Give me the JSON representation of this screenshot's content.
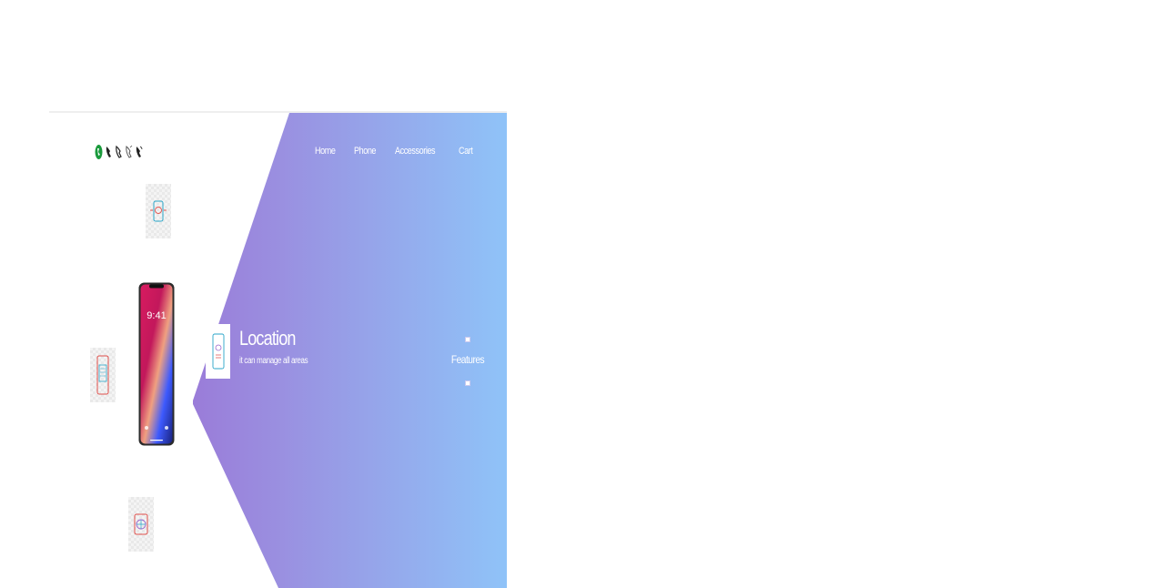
{
  "nav": {
    "items": [
      {
        "label": "Home"
      },
      {
        "label": "Phone"
      },
      {
        "label": "Accessories"
      },
      {
        "label": "Cart"
      }
    ]
  },
  "hero": {
    "title": "Location",
    "subtitle": "it can manage all areas"
  },
  "features": {
    "label": "Features"
  },
  "icons": {
    "logo": "phone-handset-icons",
    "feature_top": "location-phone-icon",
    "feature_left": "tablet-screen-icon",
    "feature_bottom": "globe-phone-icon"
  },
  "colors": {
    "gradient_start": "#9a5ccc",
    "gradient_end": "#8fc3f8",
    "logo_green": "#1a9a3c"
  }
}
